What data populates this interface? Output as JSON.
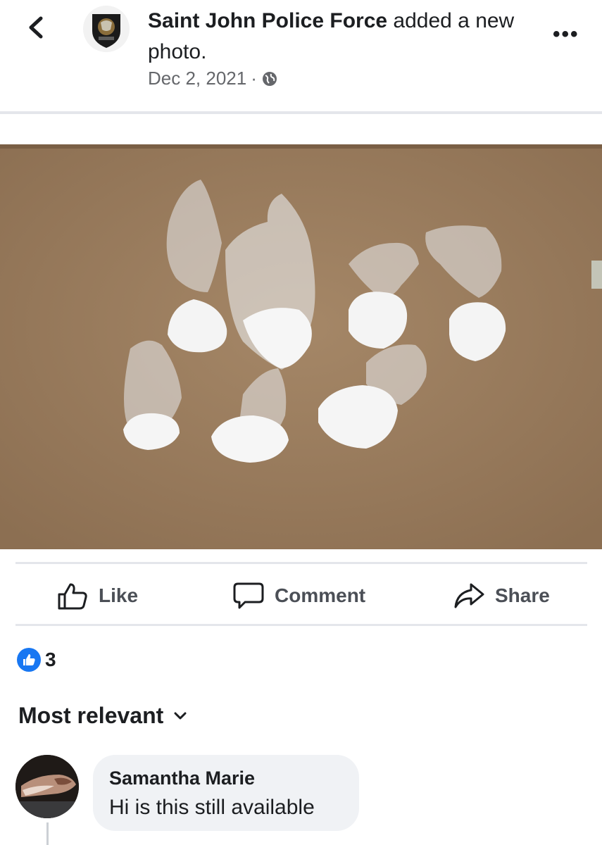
{
  "header": {
    "author": "Saint John Police Force",
    "action": " added a new photo.",
    "date": "Dec 2, 2021",
    "separator": "·",
    "more": "•••"
  },
  "actions": {
    "like": "Like",
    "comment": "Comment",
    "share": "Share"
  },
  "reactions": {
    "count": "3"
  },
  "comments": {
    "filter": "Most relevant",
    "items": [
      {
        "author": "Samantha Marie",
        "text": "Hi is this still available"
      }
    ]
  },
  "colors": {
    "accent": "#1877f2",
    "bubble": "#f0f2f5",
    "muted": "#65676b"
  }
}
